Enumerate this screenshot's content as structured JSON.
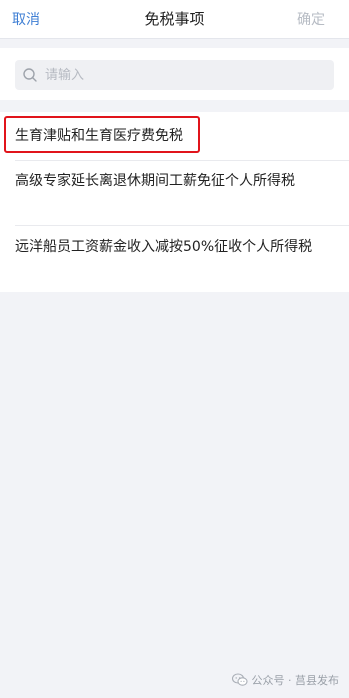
{
  "nav": {
    "cancel_label": "取消",
    "title": "免税事项",
    "confirm_label": "确定"
  },
  "search": {
    "placeholder": "请输入",
    "value": ""
  },
  "list": {
    "items": [
      {
        "label": "生育津贴和生育医疗费免税"
      },
      {
        "label": "高级专家延长离退休期间工薪免征个人所得税"
      },
      {
        "label": "远洋船员工资薪金收入减按50%征收个人所得税"
      }
    ]
  },
  "footer": {
    "text": "公众号 · 莒县发布",
    "icon": "wechat-icon"
  },
  "colors": {
    "accent": "#3f7fd4",
    "disabled": "#b7bcc4",
    "highlight": "#e1141b",
    "background": "#f2f3f7"
  }
}
